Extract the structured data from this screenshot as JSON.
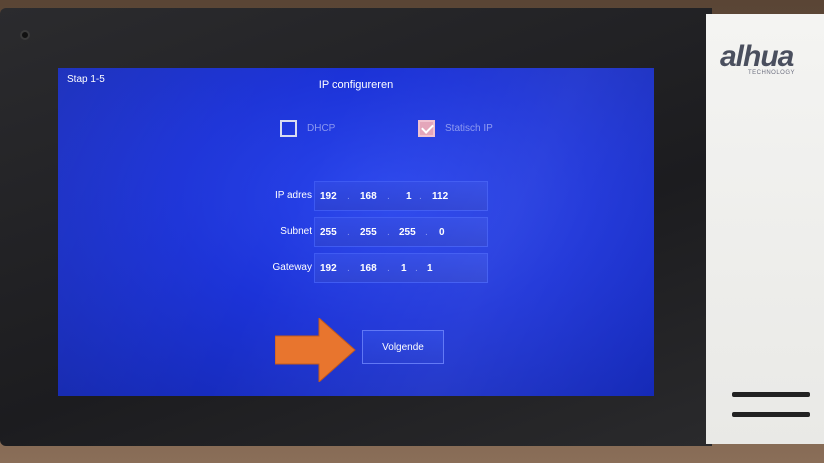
{
  "device": {
    "brand": "alhua",
    "brand_sub": "TECHNOLOGY"
  },
  "screen": {
    "step": "Stap 1-5",
    "title": "IP configureren"
  },
  "options": {
    "dhcp": {
      "label": "DHCP",
      "checked": false
    },
    "static": {
      "label": "Statisch IP",
      "checked": true
    }
  },
  "fields": {
    "ip": {
      "label": "IP adres",
      "octets": [
        "192",
        "168",
        "1",
        "112"
      ]
    },
    "subnet": {
      "label": "Subnet",
      "octets": [
        "255",
        "255",
        "255",
        "0"
      ]
    },
    "gateway": {
      "label": "Gateway",
      "octets": [
        "192",
        "168",
        "1",
        "1"
      ]
    }
  },
  "buttons": {
    "next_label": "Volgende"
  },
  "colors": {
    "screen": "#1c33d8",
    "arrow": "#e8752e",
    "checkbox_checked": "#e3a4b8"
  }
}
